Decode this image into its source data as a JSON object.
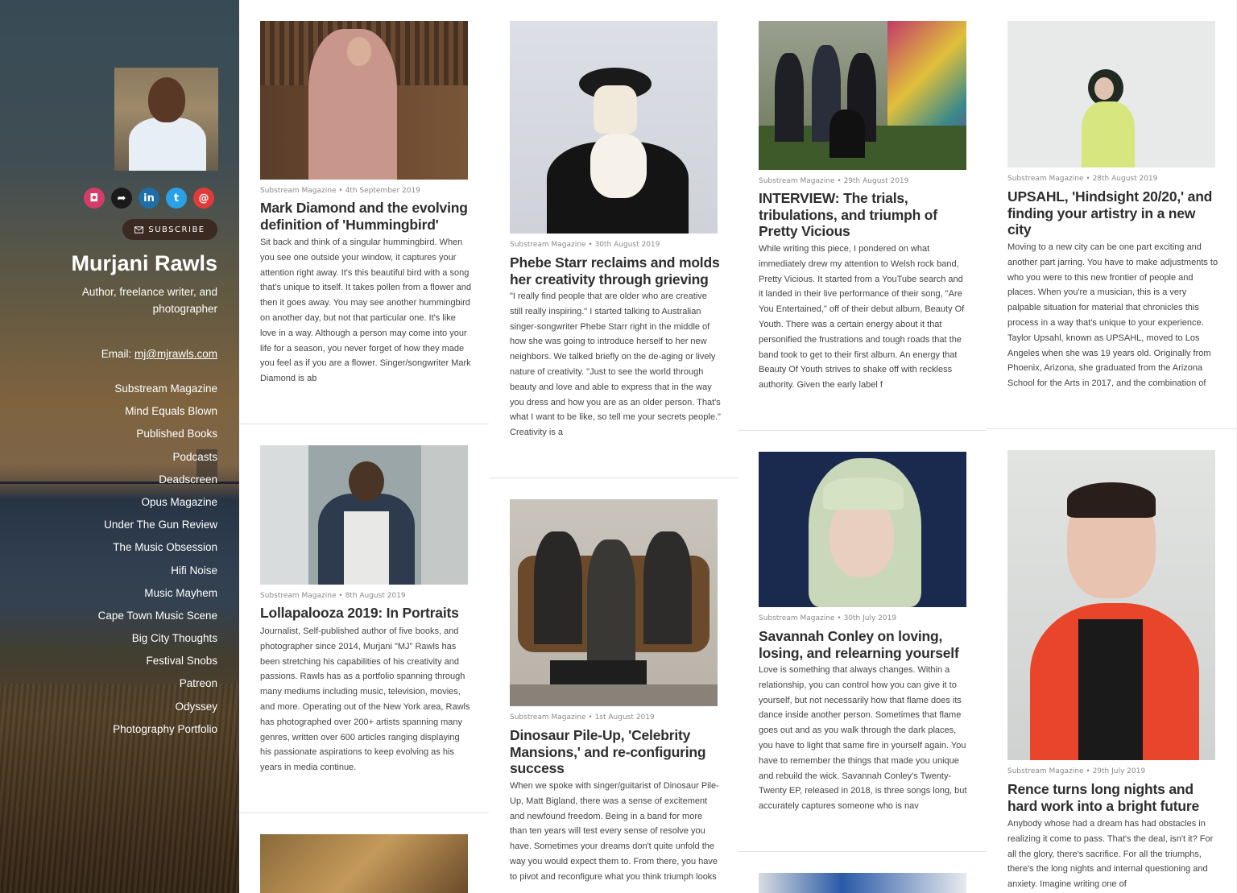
{
  "sidebar": {
    "social": [
      {
        "icon": "instagram-icon",
        "glyph": "◘"
      },
      {
        "icon": "share-icon",
        "glyph": "➦"
      },
      {
        "icon": "linkedin-icon",
        "glyph": "in"
      },
      {
        "icon": "twitter-icon",
        "glyph": "t"
      },
      {
        "icon": "email-icon",
        "glyph": "@"
      }
    ],
    "subscribe_label": "SUBSCRIBE",
    "name": "Murjani Rawls",
    "tagline": "Author, freelance writer, and photographer",
    "email_label": "Email:",
    "email_value": "mj@mjrawls.com",
    "nav": [
      "Substream Magazine",
      "Mind Equals Blown",
      "Published Books",
      "Podcasts",
      "Deadscreen",
      "Opus Magazine",
      "Under The Gun Review",
      "The Music Obsession",
      "Hifi Noise",
      "Music Mayhem",
      "Cape Town Music Scene",
      "Big City Thoughts",
      "Festival Snobs",
      "Patreon",
      "Odyssey",
      "Photography Portfolio"
    ]
  },
  "posts": {
    "p1": {
      "source": "Substream Magazine",
      "date": "4th September 2019",
      "title": "Mark Diamond and the evolving definition of 'Hummingbird'",
      "excerpt": "Sit back and think of a singular hummingbird. When you see one outside your window, it captures your attention right away. It's this beautiful bird with a song that's unique to itself. It takes pollen from a flower and then it goes away. You may see another hummingbird on another day, but not that particular one. It's like love in a way. Although a person may come into your life for a season, you never forget of how they made you feel as if you are a flower. Singer/songwriter Mark Diamond is ab"
    },
    "p2": {
      "source": "Substream Magazine",
      "date": "8th August 2019",
      "title": "Lollapalooza 2019: In Portraits",
      "excerpt": "Journalist, Self-published author of five books, and photographer since 2014, Murjani \"MJ\" Rawls has been stretching his capabilities of his creativity and passions. Rawls has as a portfolio spanning through many mediums including music, television, movies, and more. Operating out of the New York area, Rawls has photographed over 200+ artists spanning many genres, written over 600 articles ranging displaying his passionate aspirations to keep evolving as his years in media continue."
    },
    "p3": {
      "source": "Substream Magazine",
      "date": "30th August 2019",
      "title": "Phebe Starr reclaims and molds her creativity through grieving",
      "excerpt": "\"I really find people that are older who are creative still really inspiring.\" I started talking to Australian singer-songwriter Phebe Starr right in the middle of how she was going to introduce herself to her new neighbors. We talked briefly on the de-aging or lively nature of creativity. \"Just to see the world through beauty and love and able to express that in the way you dress and how you are as an older person. That's what I want to be like, so tell me your secrets people.\" Creativity is a"
    },
    "p4": {
      "source": "Substream Magazine",
      "date": "1st August 2019",
      "title": "Dinosaur Pile-Up, 'Celebrity Mansions,' and re-configuring success",
      "excerpt": "When we spoke with singer/guitarist of Dinosaur Pile-Up, Matt Bigland, there was a sense of excitement and newfound freedom. Being in a band for more than ten years will test every sense of resolve you have. Sometimes your dreams don't quite unfold the way you would expect them to. From there, you have to pivot and reconfigure what you think triumph looks"
    },
    "p5": {
      "source": "Substream Magazine",
      "date": "29th August 2019",
      "title": "INTERVIEW: The trials, tribulations, and triumph of Pretty Vicious",
      "excerpt": "While writing this piece, I pondered on what immediately drew my attention to Welsh rock band, Pretty Vicious. It started from a YouTube search and it landed in their live performance of their song, \"Are You Entertained,\" off of their debut album, Beauty Of Youth. There was a certain energy about it that personified the frustrations and tough roads that the band took to get to their first album. An energy that Beauty Of Youth strives to shake off with reckless authority. Given the early label f"
    },
    "p6": {
      "source": "Substream Magazine",
      "date": "30th July 2019",
      "title": "Savannah Conley on loving, losing, and relearning yourself",
      "excerpt": "Love is something that always changes. Within a relationship, you can control how you can give it to yourself, but not necessarily how that flame does its dance inside another person. Sometimes that flame goes out and as you walk through the dark places, you have to light that same fire in yourself again. You have to remember the things that made you unique and rebuild the wick. Savannah Conley's Twenty-Twenty EP, released in 2018, is three songs long, but accurately captures someone who is nav"
    },
    "p7": {
      "source": "Substream Magazine",
      "date": "28th August 2019",
      "title": "UPSAHL, 'Hindsight 20/20,' and finding your artistry in a new city",
      "excerpt": "Moving to a new city can be one part exciting and another part jarring. You have to make adjustments to who you were to this new frontier of people and places. When you're a musician, this is a very palpable situation for material that chronicles this process in a way that's unique to your experience. Taylor Upsahl, known as UPSAHL, moved to Los Angeles when she was 19 years old. Originally from Phoenix, Arizona, she graduated from the Arizona School for the Arts in 2017, and the combination of"
    },
    "p8": {
      "source": "Substream Magazine",
      "date": "29th July 2019",
      "title": "Rence turns long nights and hard work into a bright future",
      "excerpt": "Anybody whose had a dream has had obstacles in realizing it come to pass. That's the deal, isn't it? For all the glory, there's sacrifice. For all the triumphs, there's the long nights and internal questioning and anxiety. Imagine writing one of"
    }
  },
  "meta_separator": "•"
}
